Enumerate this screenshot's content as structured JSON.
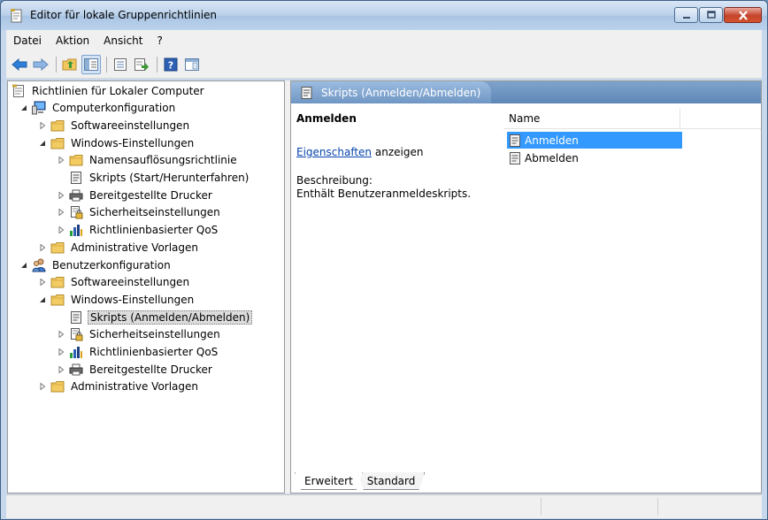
{
  "window": {
    "title": "Editor für lokale Gruppenrichtlinien"
  },
  "menu": [
    "Datei",
    "Aktion",
    "Ansicht",
    "?"
  ],
  "tree": [
    {
      "label": "Richtlinien für Lokaler Computer",
      "level": 0,
      "expand": "none",
      "icon": "policy-doc-icon"
    },
    {
      "label": "Computerkonfiguration",
      "level": 1,
      "expand": "open",
      "icon": "computer-icon"
    },
    {
      "label": "Softwareeinstellungen",
      "level": 2,
      "expand": "closed",
      "icon": "folder-icon"
    },
    {
      "label": "Windows-Einstellungen",
      "level": 2,
      "expand": "open",
      "icon": "folder-icon"
    },
    {
      "label": "Namensauflösungsrichtlinie",
      "level": 3,
      "expand": "closed",
      "icon": "folder-icon"
    },
    {
      "label": "Skripts (Start/Herunterfahren)",
      "level": 3,
      "expand": "none",
      "icon": "script-icon"
    },
    {
      "label": "Bereitgestellte Drucker",
      "level": 3,
      "expand": "closed",
      "icon": "printer-icon"
    },
    {
      "label": "Sicherheitseinstellungen",
      "level": 3,
      "expand": "closed",
      "icon": "security-icon"
    },
    {
      "label": "Richtlinienbasierter QoS",
      "level": 3,
      "expand": "closed",
      "icon": "qos-chart-icon"
    },
    {
      "label": "Administrative Vorlagen",
      "level": 2,
      "expand": "closed",
      "icon": "folder-icon"
    },
    {
      "label": "Benutzerkonfiguration",
      "level": 1,
      "expand": "open",
      "icon": "users-icon"
    },
    {
      "label": "Softwareeinstellungen",
      "level": 2,
      "expand": "closed",
      "icon": "folder-icon"
    },
    {
      "label": "Windows-Einstellungen",
      "level": 2,
      "expand": "open",
      "icon": "folder-icon"
    },
    {
      "label": "Skripts (Anmelden/Abmelden)",
      "level": 3,
      "expand": "none",
      "icon": "script-icon",
      "selected": true
    },
    {
      "label": "Sicherheitseinstellungen",
      "level": 3,
      "expand": "closed",
      "icon": "security-icon"
    },
    {
      "label": "Richtlinienbasierter QoS",
      "level": 3,
      "expand": "closed",
      "icon": "qos-chart-icon"
    },
    {
      "label": "Bereitgestellte Drucker",
      "level": 3,
      "expand": "closed",
      "icon": "printer-icon"
    },
    {
      "label": "Administrative Vorlagen",
      "level": 2,
      "expand": "closed",
      "icon": "folder-icon"
    }
  ],
  "details": {
    "header_title": "Skripts (Anmelden/Abmelden)",
    "section_title": "Anmelden",
    "link_text": "Eigenschaften",
    "link_suffix": " anzeigen",
    "desc_label": "Beschreibung:",
    "desc_text": "Enthält Benutzeranmeldeskripts."
  },
  "list": {
    "column_name": "Name",
    "items": [
      {
        "label": "Anmelden",
        "selected": true
      },
      {
        "label": "Abmelden",
        "selected": false
      }
    ]
  },
  "view_tabs": [
    {
      "label": "Erweitert",
      "active": true
    },
    {
      "label": "Standard",
      "active": false
    }
  ],
  "colors": {
    "selection": "#3399ff",
    "link": "#0645ad",
    "header": "#6f96c4"
  }
}
